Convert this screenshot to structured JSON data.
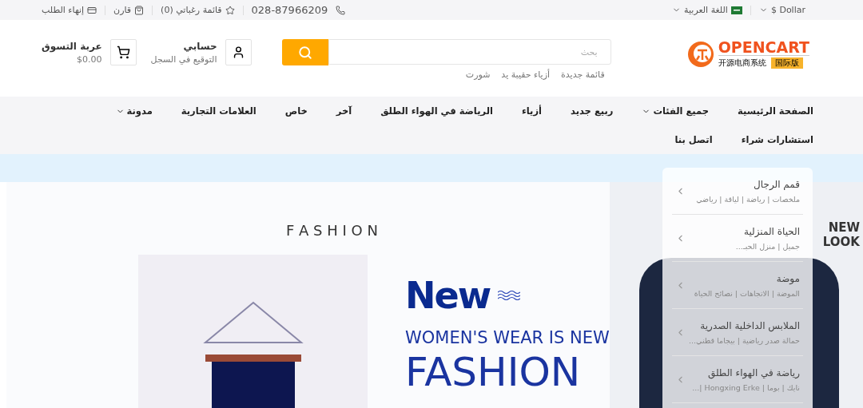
{
  "top_bar": {
    "currency": "Dollar $",
    "language": "اللغة العربية",
    "phone": "028-87966209",
    "wishlist": "قائمة رغباتي (0)",
    "compare": "قارن",
    "checkout": "إنهاء الطلب"
  },
  "logo": {
    "name": "OPENCART",
    "subtitle": "开源电商系统",
    "badge": "国际版"
  },
  "search": {
    "placeholder": "بحث",
    "suggestions": [
      "قائمة جديدة",
      "أزياء حقيبة يد",
      "شورت"
    ]
  },
  "account": {
    "title": "حسابي",
    "subtitle": "التوقيع في السجل"
  },
  "cart": {
    "title": "عربة التسوق",
    "total": "$0.00"
  },
  "nav": [
    {
      "label": "الصفحة الرئيسية",
      "dropdown": false
    },
    {
      "label": "جميع الفئات",
      "dropdown": true
    },
    {
      "label": "ربيع جديد",
      "dropdown": false
    },
    {
      "label": "أزياء",
      "dropdown": false
    },
    {
      "label": "الرياضة في الهواء الطلق",
      "dropdown": false
    },
    {
      "label": "آخر",
      "dropdown": false
    },
    {
      "label": "خاص",
      "dropdown": false
    },
    {
      "label": "العلامات التجارية",
      "dropdown": false
    },
    {
      "label": "مدونة",
      "dropdown": true
    },
    {
      "label": "استشارات شراء",
      "dropdown": false
    },
    {
      "label": "اتصل بنا",
      "dropdown": false
    }
  ],
  "banner": {
    "title": "F A S H I O N",
    "headline": "New",
    "tagline": "WOMEN'S WEAR IS NEW",
    "big_text": "FASHION",
    "side_text": "NEW LOOK"
  },
  "categories": [
    {
      "name": "قمم الرجال",
      "subtitle": "ملخصات | رياضة | لياقة | رياضي"
    },
    {
      "name": "الحياة المنزلية",
      "subtitle": "جميل | منزل الحبـ..."
    },
    {
      "name": "موضة",
      "subtitle": "الموضة | الاتجاهات | نصائح الحياة"
    },
    {
      "name": "الملابس الداخلية الصدرية",
      "subtitle": "حمالة صدر رياضية | بيجاما قطني..."
    },
    {
      "name": "رياضة في الهواء الطلق",
      "subtitle": "نايك | بوما | Hongxing Erke |..."
    }
  ]
}
